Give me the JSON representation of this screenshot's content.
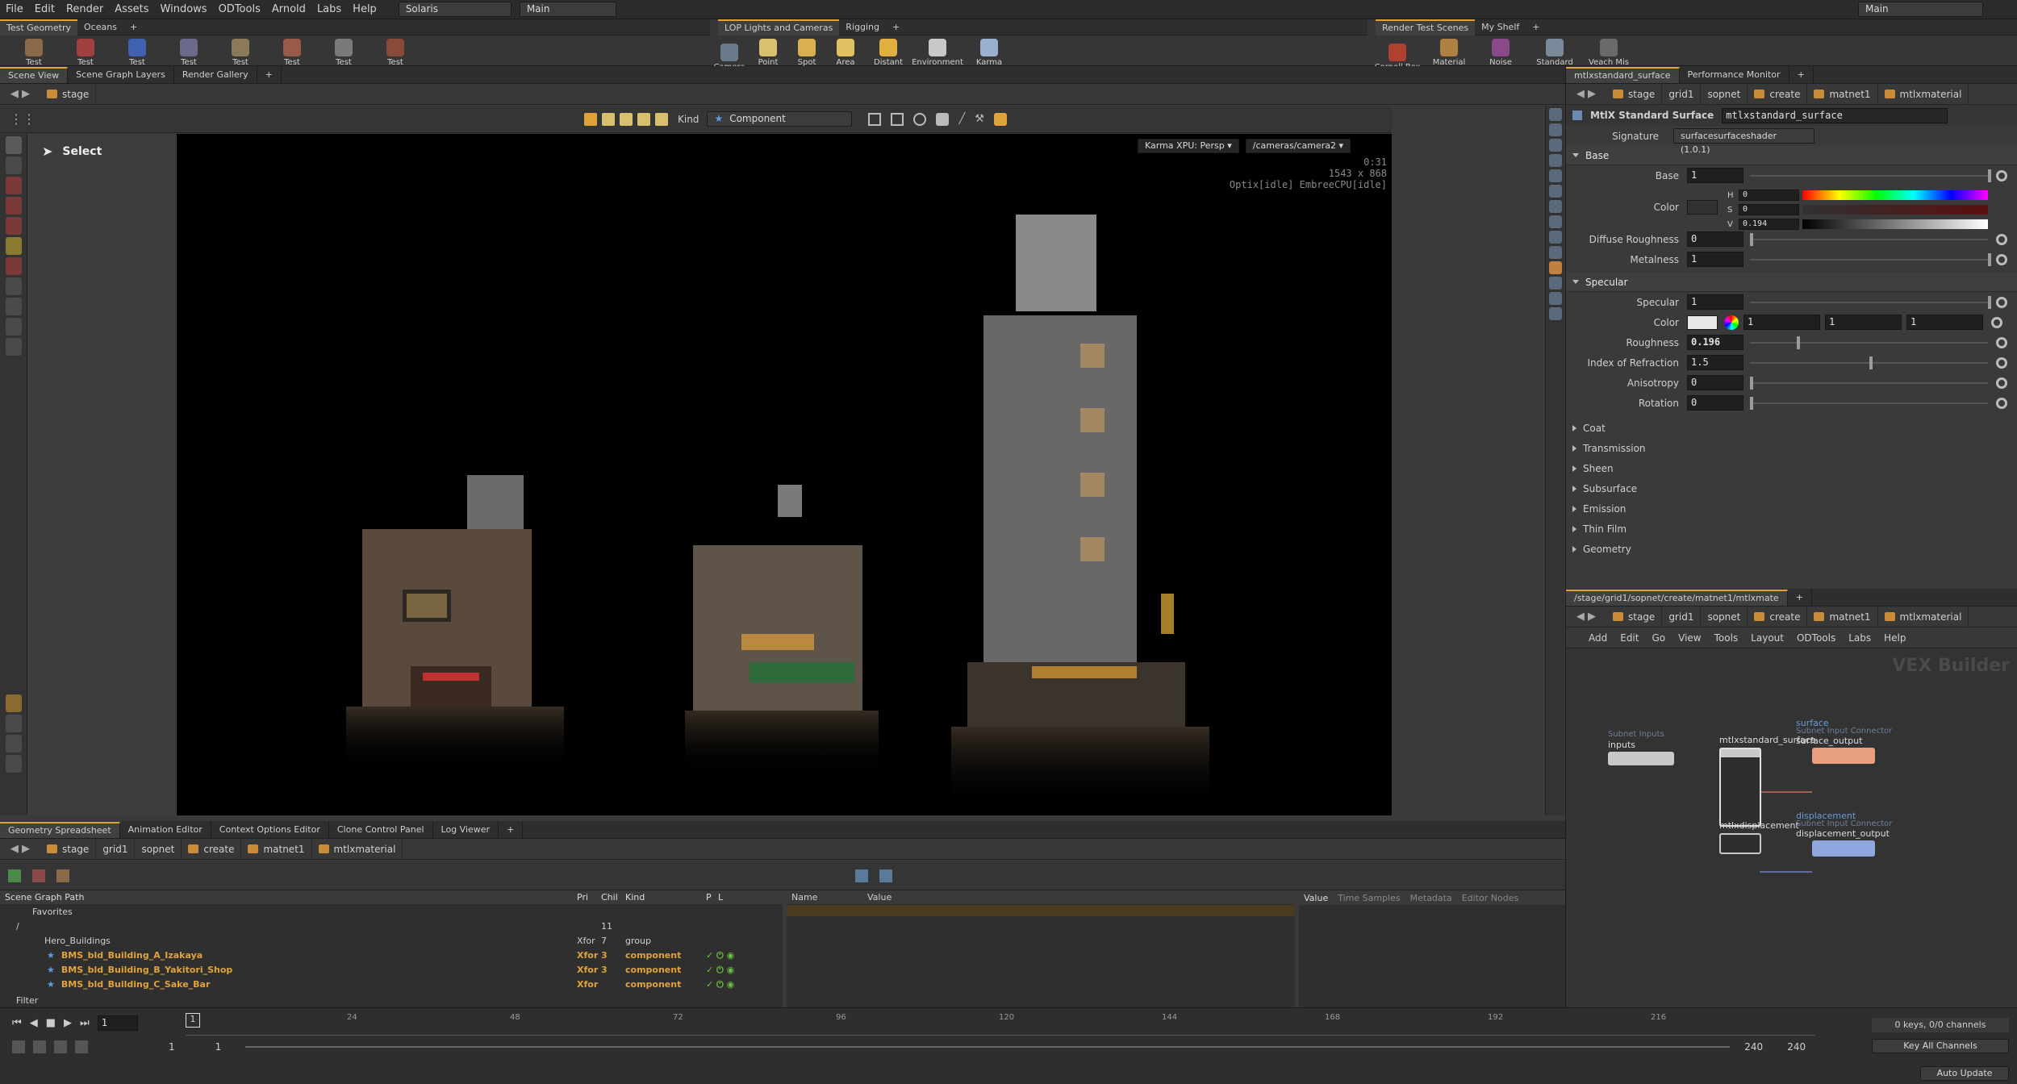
{
  "menubar": {
    "items": [
      "File",
      "Edit",
      "Render",
      "Assets",
      "Windows",
      "ODTools",
      "Arnold",
      "Labs",
      "Help"
    ],
    "desktop": "Solaris",
    "network": "Main",
    "right_network": "Main"
  },
  "shelf_left": {
    "tabs": [
      "Test Geometry",
      "Oceans"
    ],
    "tools": [
      "Test Geometry: C...",
      "Test Geometry: P...",
      "Test Geometry: R...",
      "Test Geometry: S...",
      "Test Geometry: S...",
      "Test Geometry: T...",
      "Test Geometry: T...",
      "Test Geometry: T..."
    ]
  },
  "shelf_mid": {
    "tabs": [
      "LOP Lights and Cameras",
      "Rigging"
    ],
    "tools": [
      "Camera",
      "Point Light",
      "Spot Light",
      "Area Light",
      "Distant Light",
      "Environment Light",
      "Karma Physical Sky"
    ]
  },
  "shelf_right": {
    "tabs": [
      "Render Test Scenes",
      "My Shelf"
    ],
    "tools": [
      "Cornell Box",
      "Material Lookdev",
      "Noise Sampler",
      "Standard Shader Ball",
      "Veach Mis Planks"
    ]
  },
  "left_panel": {
    "tabs": [
      "Scene View",
      "Scene Graph Layers",
      "Render Gallery"
    ],
    "path": "stage",
    "kind_label": "Kind",
    "kind_value": "Component",
    "select_label": "Select"
  },
  "viewport": {
    "renderer": "Karma XPU: Persp",
    "camera": "/cameras/camera2",
    "time": "0:31",
    "resolution": "1543 x 868",
    "engine_status": "Optix[idle] EmbreeCPU[idle]"
  },
  "params": {
    "tabs": [
      "mtlxstandard_surface",
      "Performance Monitor"
    ],
    "path": [
      "stage",
      "grid1",
      "sopnet",
      "create",
      "matnet1",
      "mtlxmaterial"
    ],
    "node_type": "MtlX Standard Surface",
    "node_name": "mtlxstandard_surface",
    "signature_label": "Signature",
    "signature_value": "surfacesurfaceshader (1.0.1)",
    "base_section": "Base",
    "base": {
      "label": "Base",
      "value": "1",
      "slider": 1.0
    },
    "color": {
      "label": "Color",
      "h_label": "H",
      "h": "0",
      "s_label": "S",
      "s": "0",
      "v_label": "V",
      "v": "0.194"
    },
    "diffuse_roughness": {
      "label": "Diffuse Roughness",
      "value": "0",
      "slider": 0.0
    },
    "metalness": {
      "label": "Metalness",
      "value": "1",
      "slider": 1.0
    },
    "specular_section": "Specular",
    "specular": {
      "label": "Specular",
      "value": "1",
      "slider": 1.0
    },
    "spec_color": {
      "label": "Color",
      "r": "1",
      "g": "1",
      "b": "1"
    },
    "roughness": {
      "label": "Roughness",
      "value": "0.196",
      "slider": 0.196
    },
    "ior": {
      "label": "Index of Refraction",
      "value": "1.5",
      "slider": 0.5
    },
    "anisotropy": {
      "label": "Anisotropy",
      "value": "0",
      "slider": 0.0
    },
    "rotation": {
      "label": "Rotation",
      "value": "0",
      "slider": 0.0
    },
    "folders": [
      "Coat",
      "Transmission",
      "Sheen",
      "Subsurface",
      "Emission",
      "Thin Film",
      "Geometry"
    ]
  },
  "network": {
    "tab": "/stage/grid1/sopnet/create/matnet1/mtlxmate",
    "path": [
      "stage",
      "grid1",
      "sopnet",
      "create",
      "matnet1",
      "mtlxmaterial"
    ],
    "menu": [
      "Add",
      "Edit",
      "Go",
      "View",
      "Tools",
      "Layout",
      "ODTools",
      "Labs",
      "Help"
    ],
    "watermark": "VEX Builder",
    "nodes": {
      "inputs_sub": "Subnet Inputs",
      "inputs": "inputs",
      "surface_node": "mtlxstandard_surface",
      "surface_conn": "surface",
      "surface_conn_sub": "Subnet Input Connector",
      "surface_output": "surface_output",
      "disp_node": "mtlxdisplacement",
      "disp_conn": "displacement",
      "disp_conn_sub": "Subnet Input Connector",
      "disp_output": "displacement_output"
    }
  },
  "bottom": {
    "tabs": [
      "Geometry Spreadsheet",
      "Animation Editor",
      "Context Options Editor",
      "Clone Control Panel",
      "Log Viewer"
    ],
    "path": [
      "stage",
      "grid1",
      "sopnet",
      "create",
      "matnet1",
      "mtlxmaterial"
    ],
    "columns": [
      "Scene Graph Path",
      "Pri",
      "Chil",
      "Kind",
      "P",
      "L"
    ],
    "favorites": "Favorites",
    "rows": [
      {
        "path": "/",
        "type": "",
        "children": "11",
        "kind": ""
      },
      {
        "path": "Hero_Buildings",
        "type": "Xfor",
        "children": "7",
        "kind": "group"
      },
      {
        "path": "BMS_bld_Building_A_Izakaya",
        "type": "Xfor",
        "children": "3",
        "kind": "component"
      },
      {
        "path": "BMS_bld_Building_B_Yakitori_Shop",
        "type": "Xfor",
        "children": "3",
        "kind": "component"
      },
      {
        "path": "BMS_bld_Building_C_Sake_Bar",
        "type": "Xfor",
        "children": "",
        "kind": "component"
      }
    ],
    "filter_label": "Filter",
    "attr_columns": [
      "Name",
      "Value"
    ],
    "value_tabs": [
      "Value",
      "Time Samples",
      "Metadata",
      "Editor Nodes"
    ]
  },
  "timeline": {
    "frame": "1",
    "ticks": [
      "24",
      "48",
      "72",
      "96",
      "120",
      "144",
      "168",
      "192",
      "216"
    ],
    "start": "1",
    "start2": "1",
    "end": "240",
    "end2": "240",
    "keys_status": "0 keys, 0/0 channels",
    "key_channels": "Key All Channels",
    "auto_update": "Auto Update"
  },
  "colors": {
    "accent": "#e0a33c",
    "field_bg": "#1f1f1f",
    "panel_bg": "#3a3a3a",
    "viewport_bg": "#000000"
  }
}
